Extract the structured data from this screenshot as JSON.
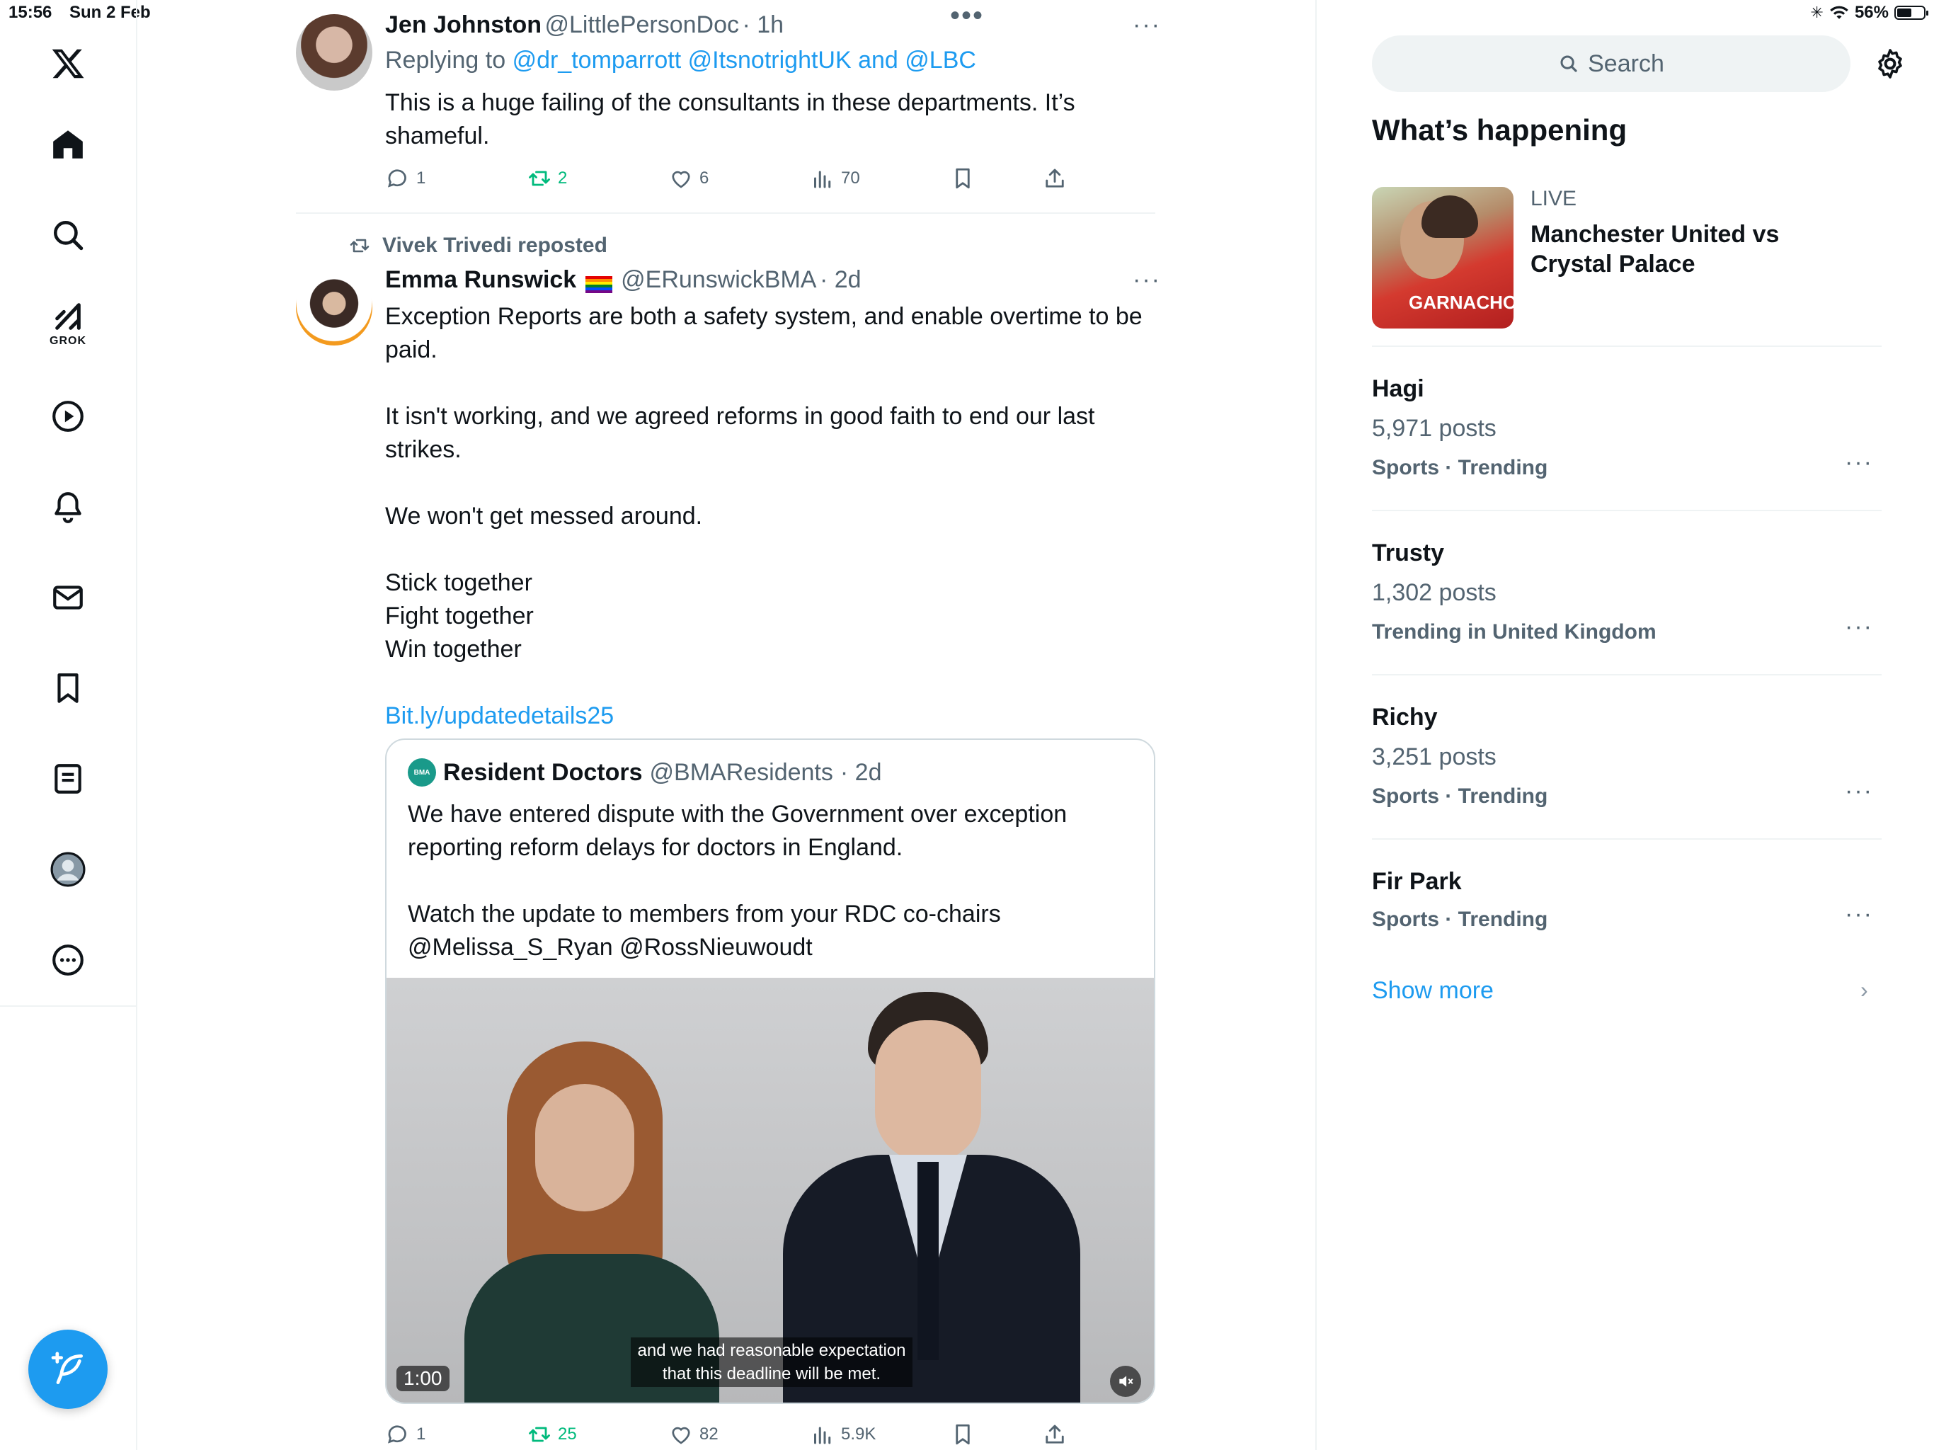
{
  "status_bar": {
    "time": "15:56",
    "date": "Sun 2 Feb",
    "battery": "56%",
    "battery_level": 0.56
  },
  "nav": {
    "items": [
      {
        "name": "x-logo-icon"
      },
      {
        "name": "home-icon"
      },
      {
        "name": "search-icon"
      },
      {
        "name": "grok-icon",
        "label": "GROK"
      },
      {
        "name": "video-icon"
      },
      {
        "name": "notifications-icon"
      },
      {
        "name": "messages-icon"
      },
      {
        "name": "bookmarks-icon"
      },
      {
        "name": "lists-icon"
      },
      {
        "name": "profile-icon"
      },
      {
        "name": "more-icon"
      }
    ]
  },
  "feed": {
    "tweet1": {
      "name": "Jen Johnston",
      "handle": "@LittlePersonDoc",
      "time": "· 1h",
      "replying_prefix": "Replying to",
      "replying_to": "@dr_tomparrott @ItsnotrightUK and @LBC",
      "text_line1": "This is a huge failing of the consultants in these departments. It’s",
      "text_line2": "shameful.",
      "replies": "1",
      "reposts": "2",
      "likes": "6",
      "views": "70"
    },
    "tweet2": {
      "repost_by": "Vivek Trivedi reposted",
      "name": "Emma Runswick",
      "flag": "🏳️‍🌈",
      "handle": "@ERunswickBMA",
      "time": "· 2d",
      "text": [
        "Exception Reports are both a safety system, and enable overtime to be",
        "paid.",
        "",
        "It isn't working, and we agreed reforms in good faith to end our last",
        "strikes.",
        "",
        "We won't get messed around.",
        "",
        "Stick together",
        "Fight together",
        "Win together"
      ],
      "link": "Bit.ly/updatedetails25",
      "quote": {
        "avatar_text": "BMA",
        "name": "Resident Doctors",
        "handle": "@BMAResidents",
        "time": "· 2d",
        "text_line1": "We have entered dispute with the Government over exception",
        "text_line2": "reporting reform delays for doctors in England.",
        "text_line3": "Watch the update to members from your RDC co-chairs",
        "text_line4": "@Melissa_S_Ryan @RossNieuwoudt",
        "video": {
          "duration": "1:00",
          "caption_line1": "and we had reasonable expectation",
          "caption_line2": "that this deadline will be met."
        }
      },
      "replies": "1",
      "reposts": "25",
      "likes": "82",
      "views": "5.9K"
    }
  },
  "sidebar": {
    "search_placeholder": "Search",
    "section_title": "What’s happening",
    "live": {
      "label": "LIVE",
      "title_line1": "Manchester United vs",
      "title_line2": "Crystal Palace",
      "image_text": "GARNACHO"
    },
    "trends": [
      {
        "title": "Hagi",
        "count": "5,971 posts",
        "category": "Sports · Trending"
      },
      {
        "title": "Trusty",
        "count": "1,302 posts",
        "category": "Trending in United Kingdom"
      },
      {
        "title": "Richy",
        "count": "3,251 posts",
        "category": "Sports · Trending"
      },
      {
        "title": "Fir Park",
        "category": "Sports · Trending"
      }
    ],
    "show_more": "Show more"
  },
  "colors": {
    "accent": "#1d9bf0",
    "repost_green": "#00ba7c",
    "secondary_text": "#536471"
  }
}
